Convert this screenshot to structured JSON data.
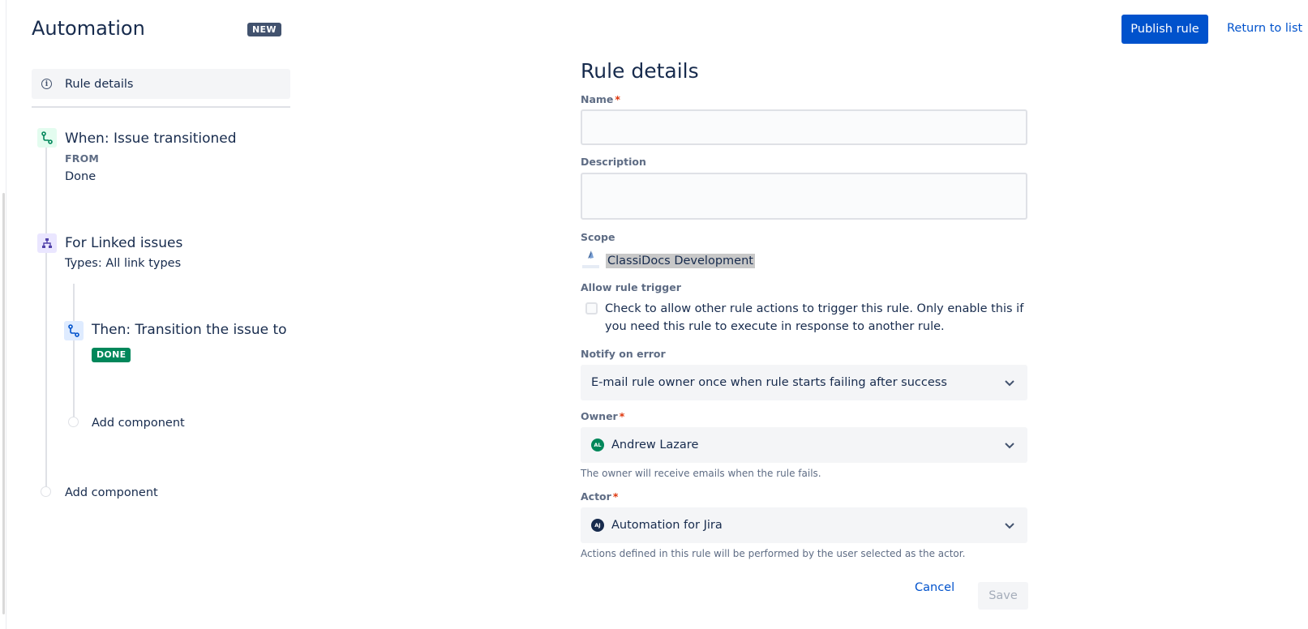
{
  "header": {
    "title": "Automation",
    "badge": "NEW",
    "publish_label": "Publish rule",
    "return_label": "Return to list"
  },
  "sidebar": {
    "rule_details_label": "Rule details",
    "trigger": {
      "title": "When: Issue transitioned",
      "from_label": "FROM",
      "from_value": "Done"
    },
    "branch": {
      "title": "For Linked issues",
      "subtitle": "Types: All link types"
    },
    "action": {
      "title": "Then: Transition the issue to",
      "status": "DONE"
    },
    "add_component_inner": "Add component",
    "add_component_outer": "Add component"
  },
  "form": {
    "heading": "Rule details",
    "name_label": "Name",
    "name_value": "",
    "description_label": "Description",
    "description_value": "",
    "scope_label": "Scope",
    "scope_value": "ClassiDocs Development",
    "allow_trigger_label": "Allow rule trigger",
    "allow_trigger_text": "Check to allow other rule actions to trigger this rule. Only enable this if you need this rule to execute in response to another rule.",
    "allow_trigger_checked": false,
    "notify_label": "Notify on error",
    "notify_value": "E-mail rule owner once when rule starts failing after success",
    "owner_label": "Owner",
    "owner_initials": "AL",
    "owner_value": "Andrew Lazare",
    "owner_helper": "The owner will receive emails when the rule fails.",
    "actor_label": "Actor",
    "actor_initials": "AJ",
    "actor_value": "Automation for Jira",
    "actor_helper": "Actions defined in this rule will be performed by the user selected as the actor.",
    "cancel_label": "Cancel",
    "save_label": "Save"
  },
  "colors": {
    "primary": "#0052cc",
    "done_green": "#00875a",
    "owner_avatar": "#00875a",
    "actor_avatar": "#172b4d"
  }
}
